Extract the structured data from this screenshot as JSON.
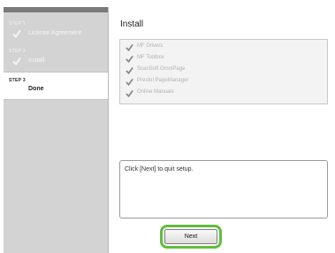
{
  "sidebar": {
    "steps": [
      {
        "number": "STEP 1",
        "label": "License Agreement",
        "state": "done"
      },
      {
        "number": "STEP 2",
        "label": "Install",
        "state": "done"
      },
      {
        "number": "STEP 3",
        "label": "Done",
        "state": "current"
      }
    ]
  },
  "main": {
    "title": "Install",
    "components": [
      {
        "label": "MF Drivers",
        "icon": "check-icon"
      },
      {
        "label": "MF Toolbox",
        "icon": "check-icon"
      },
      {
        "label": "ScanSoft OmniPage",
        "icon": "check-icon"
      },
      {
        "label": "Presto! PageManager",
        "icon": "check-icon"
      },
      {
        "label": "Online Manuals",
        "icon": "check-icon"
      }
    ],
    "message": "Click [Next] to quit setup.",
    "next_label": "Next"
  },
  "colors": {
    "sidebar_bg": "#d3d3d3",
    "highlight_ring": "#5fbe3b",
    "check_done": "#8a8a8a"
  }
}
